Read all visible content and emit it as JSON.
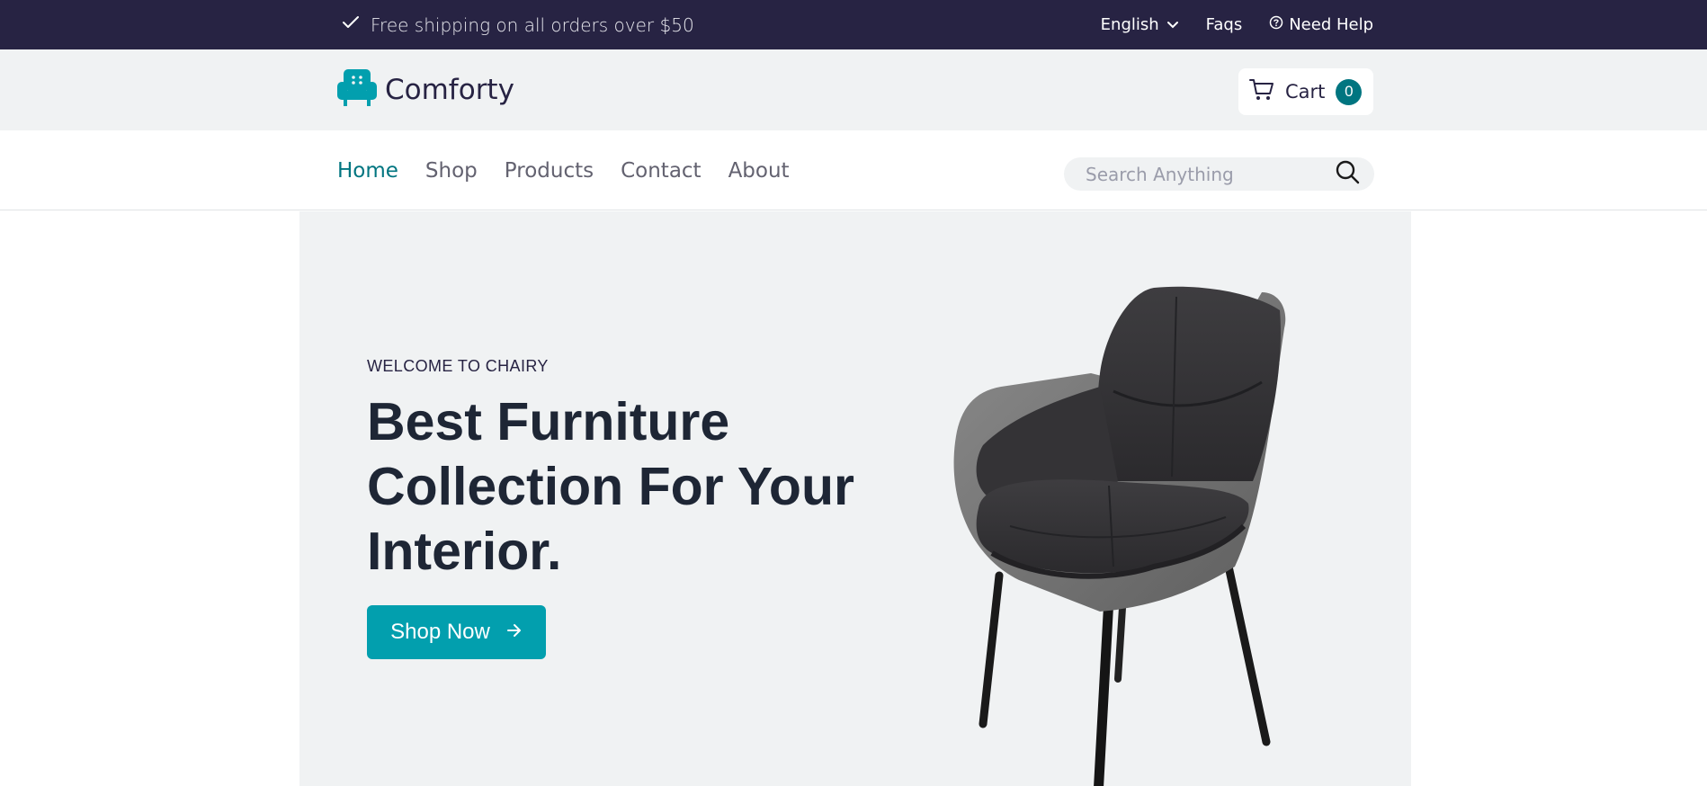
{
  "topbar": {
    "shipping_text": "Free shipping on all orders over $50",
    "language": "English",
    "faqs": "Faqs",
    "help": "Need Help"
  },
  "brand": {
    "name": "Comforty",
    "accent": "#029fae",
    "dark": "#272343",
    "teal": "#007580"
  },
  "cart": {
    "label": "Cart",
    "count": "0"
  },
  "nav": {
    "items": [
      {
        "label": "Home",
        "active": true
      },
      {
        "label": "Shop"
      },
      {
        "label": "Products"
      },
      {
        "label": "Contact"
      },
      {
        "label": "About"
      }
    ]
  },
  "search": {
    "placeholder": "Search Anything"
  },
  "hero": {
    "eyebrow": "WELCOME TO CHAIRY",
    "heading_line1": "Best Furniture",
    "heading_line2": "Collection For Your",
    "heading_line3": "Interior.",
    "cta_label": "Shop Now"
  },
  "icons": {
    "check": "check-icon",
    "chevron": "chevron-down-icon",
    "help": "question-circle-icon",
    "logo": "armchair-logo-icon",
    "cart": "cart-icon",
    "search": "search-icon",
    "arrow": "arrow-right-icon"
  }
}
